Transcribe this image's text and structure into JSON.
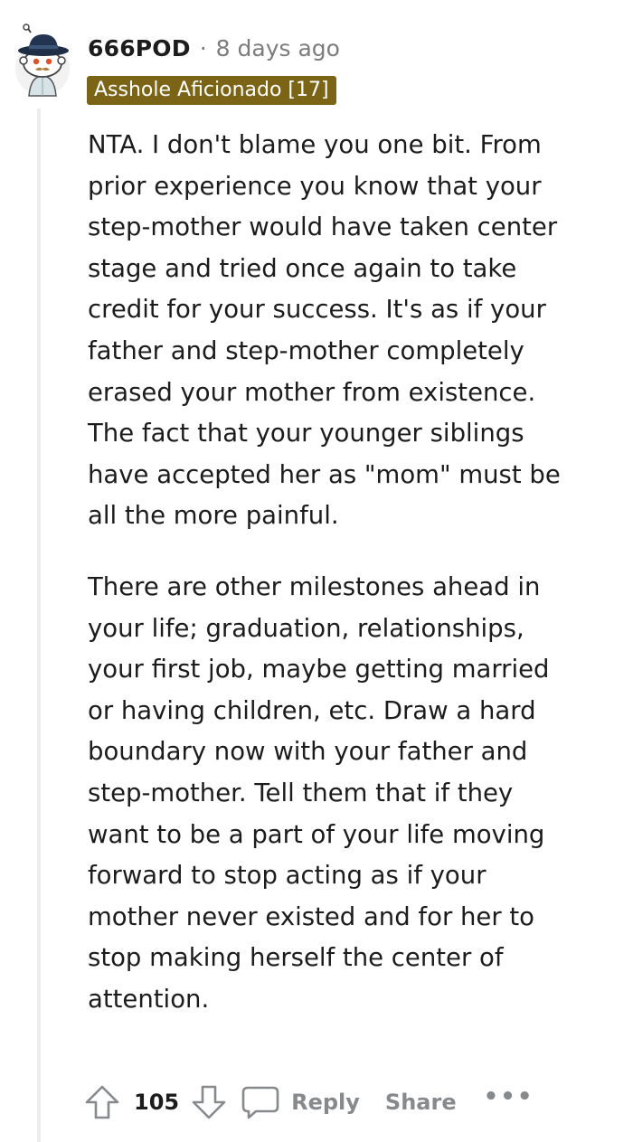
{
  "comment": {
    "username": "666POD",
    "separator": "·",
    "timestamp": "8 days ago",
    "flair": "Asshole Aficionado [17]",
    "paragraphs": [
      "NTA. I don't blame you one bit. From prior experience you know that your step-mother would have taken center stage and tried once again to take credit for your success. It's as if your father and step-mother completely erased your mother from existence. The fact that your younger siblings have accepted her as \"mom\" must be all the more painful.",
      "There are other milestones ahead in your life; graduation, relationships, your first job, maybe getting married or having children, etc. Draw a hard boundary now with your father and step-mother. Tell them that if they want to be a part of your life moving forward to stop acting as if your mother never existed and for her to stop making herself the center of attention."
    ],
    "score": "105",
    "reply_label": "Reply",
    "share_label": "Share",
    "more_label": "•••"
  },
  "colors": {
    "flair_bg": "#7c6416",
    "muted": "#878a8c",
    "text": "#1c1c1c"
  },
  "icons": {
    "avatar": "snoo-avatar-hat-mustache",
    "upvote": "upvote-arrow-icon",
    "downvote": "downvote-arrow-icon",
    "reply": "comment-bubble-icon",
    "more": "more-options-icon"
  }
}
